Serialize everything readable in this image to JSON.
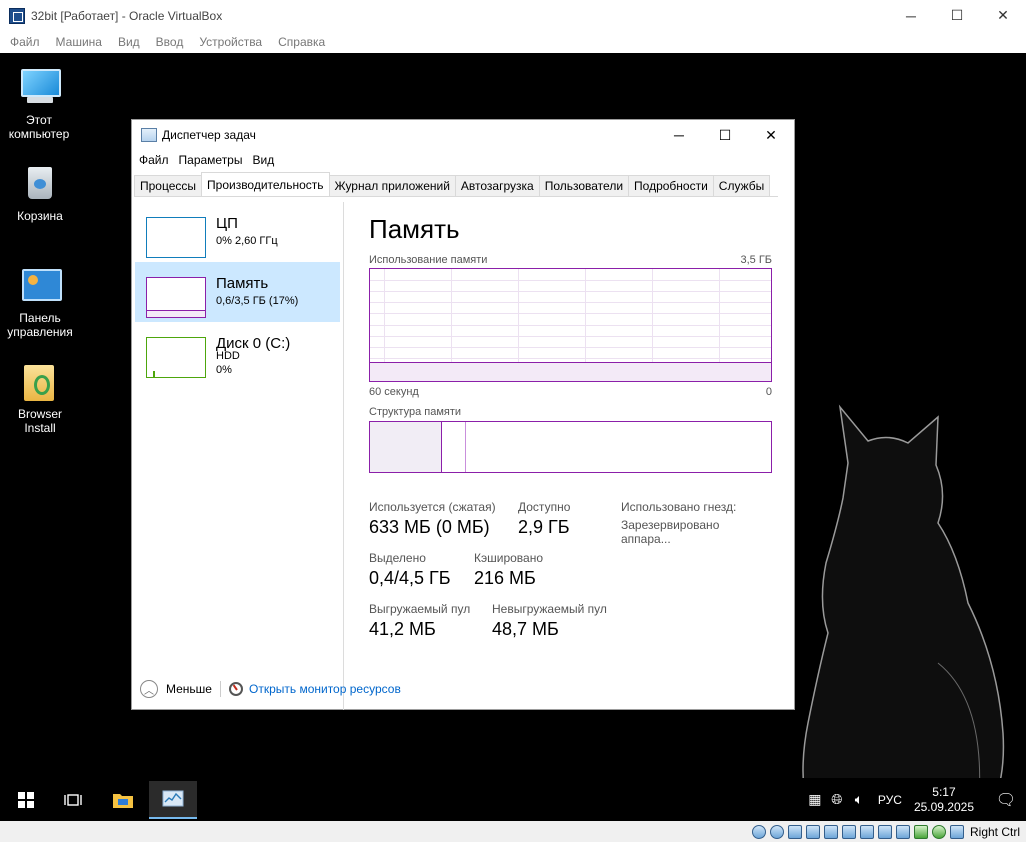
{
  "vbox": {
    "title": "32bit [Работает] - Oracle VirtualBox",
    "window_buttons": {
      "minimize": "─",
      "maximize": "☐",
      "close": "✕"
    },
    "menu": [
      "Файл",
      "Машина",
      "Вид",
      "Ввод",
      "Устройства",
      "Справка"
    ],
    "host_key": "Right Ctrl"
  },
  "desktop": {
    "icons": [
      {
        "label": "Этот компьютер",
        "icon": "computer-icon"
      },
      {
        "label": "Корзина",
        "icon": "recycle-bin-icon"
      },
      {
        "label": "Панель управления",
        "icon": "control-panel-icon"
      },
      {
        "label": "Browser Install",
        "icon": "browser-install-folder-icon"
      }
    ]
  },
  "task_manager": {
    "title": "Диспетчер задач",
    "window_buttons": {
      "minimize": "─",
      "maximize": "☐",
      "close": "✕"
    },
    "menu": [
      "Файл",
      "Параметры",
      "Вид"
    ],
    "tabs": [
      "Процессы",
      "Производительность",
      "Журнал приложений",
      "Автозагрузка",
      "Пользователи",
      "Подробности",
      "Службы"
    ],
    "active_tab": "Производительность",
    "sidebar": [
      {
        "name": "ЦП",
        "line1": "0%  2,60 ГГц",
        "line2": "",
        "color": "#117dbb"
      },
      {
        "name": "Память",
        "line1": "0,6/3,5 ГБ (17%)",
        "line2": "",
        "color": "#8b1fa9",
        "selected": true
      },
      {
        "name": "Диск 0 (C:)",
        "line1": "HDD",
        "line2": "0%",
        "color": "#4da60c"
      }
    ],
    "main": {
      "title": "Память",
      "usage_label": "Использование памяти",
      "usage_max": "3,5 ГБ",
      "time_left": "60 секунд",
      "time_right": "0",
      "usage_fraction": 0.17,
      "structure_label": "Структура памяти",
      "structure_in_use_fraction": 0.18,
      "structure_modified_fraction": 0.06,
      "stats": {
        "in_use_label": "Используется (сжатая)",
        "in_use_value": "633 МБ (0 МБ)",
        "available_label": "Доступно",
        "available_value": "2,9 ГБ",
        "committed_label": "Выделено",
        "committed_value": "0,4/4,5 ГБ",
        "cached_label": "Кэшировано",
        "cached_value": "216 МБ",
        "paged_label": "Выгружаемый пул",
        "paged_value": "41,2 МБ",
        "nonpaged_label": "Невыгружаемый пул",
        "nonpaged_value": "48,7 МБ",
        "slots_label": "Использовано гнезд:",
        "reserved_label": "Зарезервировано аппара..."
      }
    },
    "footer": {
      "less_label": "Меньше",
      "resmon_link": "Открыть монитор ресурсов"
    }
  },
  "taskbar": {
    "lang": "РУС",
    "time": "5:17",
    "date": "25.09.2025"
  }
}
